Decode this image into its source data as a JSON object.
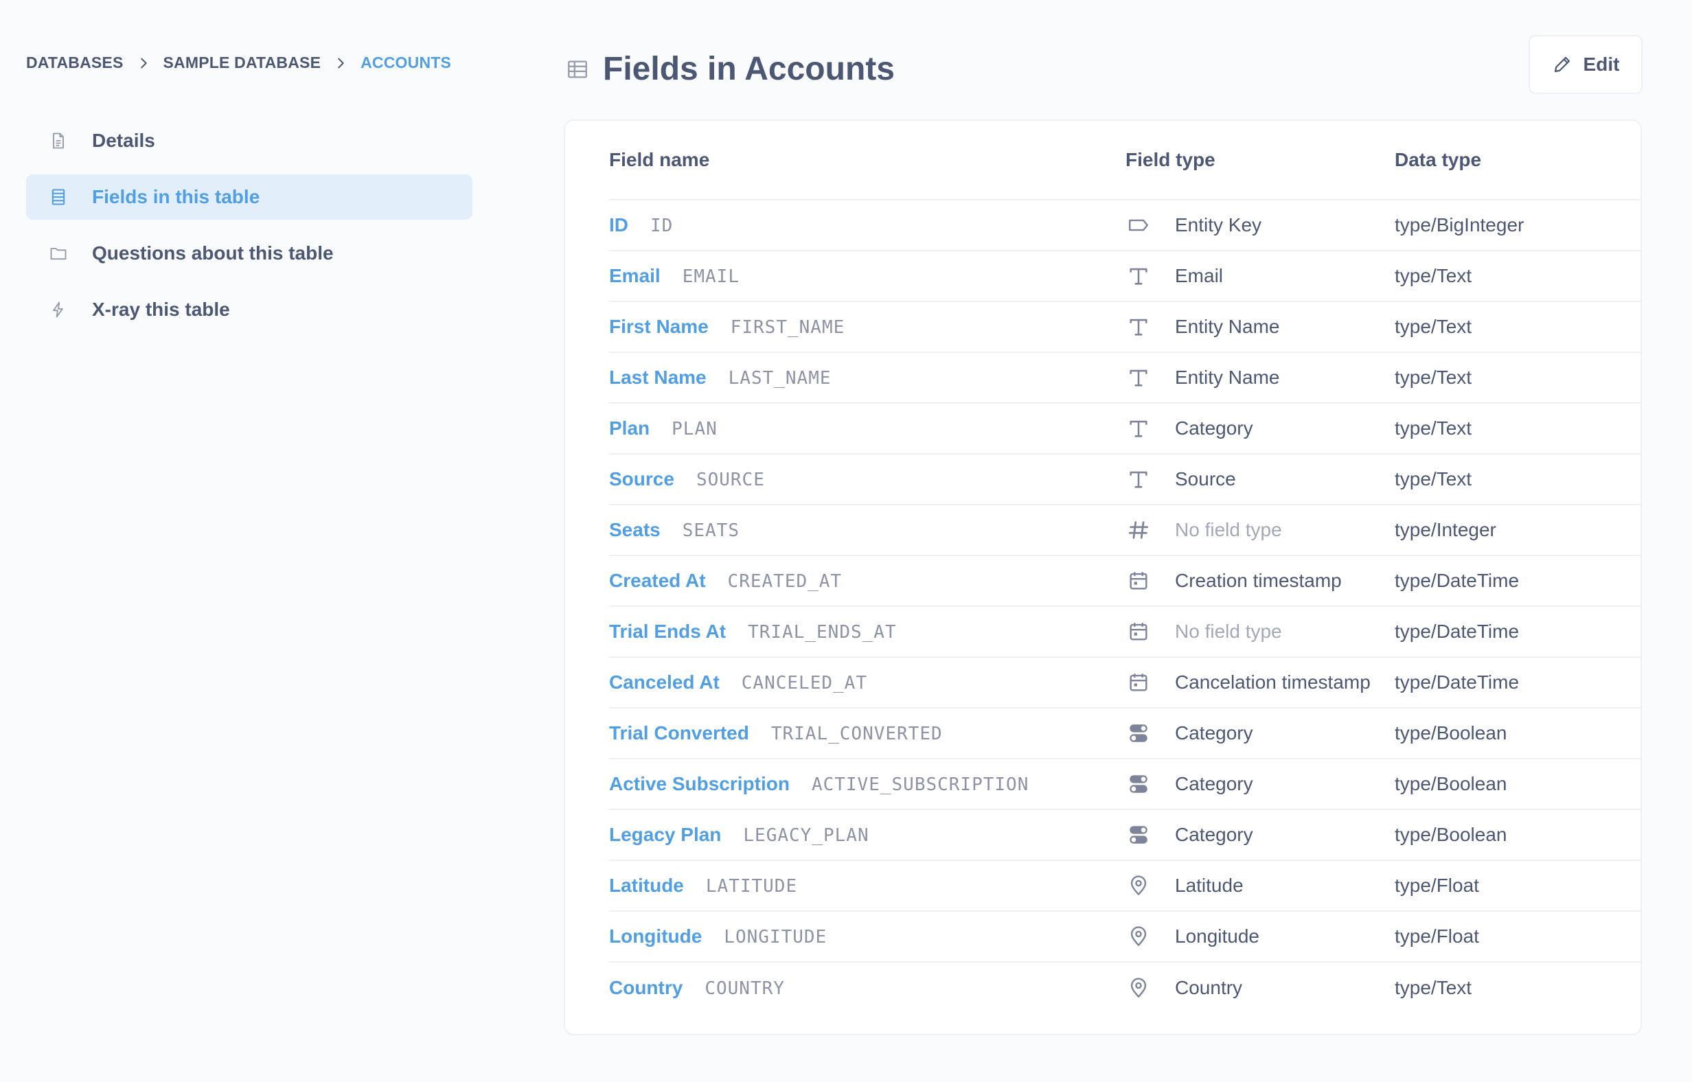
{
  "breadcrumb": {
    "items": [
      "DATABASES",
      "SAMPLE DATABASE",
      "ACCOUNTS"
    ]
  },
  "sidebar": {
    "items": [
      {
        "label": "Details",
        "icon": "document-icon"
      },
      {
        "label": "Fields in this table",
        "icon": "list-icon",
        "selected": true
      },
      {
        "label": "Questions about this table",
        "icon": "folder-icon"
      },
      {
        "label": "X-ray this table",
        "icon": "bolt-icon"
      }
    ]
  },
  "header": {
    "title": "Fields in Accounts",
    "edit_label": "Edit"
  },
  "table": {
    "columns": [
      "Field name",
      "Field type",
      "Data type"
    ],
    "rows": [
      {
        "name": "ID",
        "raw": "ID",
        "field_type": "Entity Key",
        "icon": "key-label-icon",
        "data_type": "type/BigInteger",
        "muted": false
      },
      {
        "name": "Email",
        "raw": "EMAIL",
        "field_type": "Email",
        "icon": "text-icon",
        "data_type": "type/Text",
        "muted": false
      },
      {
        "name": "First Name",
        "raw": "FIRST_NAME",
        "field_type": "Entity Name",
        "icon": "text-icon",
        "data_type": "type/Text",
        "muted": false
      },
      {
        "name": "Last Name",
        "raw": "LAST_NAME",
        "field_type": "Entity Name",
        "icon": "text-icon",
        "data_type": "type/Text",
        "muted": false
      },
      {
        "name": "Plan",
        "raw": "PLAN",
        "field_type": "Category",
        "icon": "text-icon",
        "data_type": "type/Text",
        "muted": false
      },
      {
        "name": "Source",
        "raw": "SOURCE",
        "field_type": "Source",
        "icon": "text-icon",
        "data_type": "type/Text",
        "muted": false
      },
      {
        "name": "Seats",
        "raw": "SEATS",
        "field_type": "No field type",
        "icon": "hash-icon",
        "data_type": "type/Integer",
        "muted": true
      },
      {
        "name": "Created At",
        "raw": "CREATED_AT",
        "field_type": "Creation timestamp",
        "icon": "calendar-icon",
        "data_type": "type/DateTime",
        "muted": false
      },
      {
        "name": "Trial Ends At",
        "raw": "TRIAL_ENDS_AT",
        "field_type": "No field type",
        "icon": "calendar-icon",
        "data_type": "type/DateTime",
        "muted": true
      },
      {
        "name": "Canceled At",
        "raw": "CANCELED_AT",
        "field_type": "Cancelation timestamp",
        "icon": "calendar-icon",
        "data_type": "type/DateTime",
        "muted": false
      },
      {
        "name": "Trial Converted",
        "raw": "TRIAL_CONVERTED",
        "field_type": "Category",
        "icon": "toggle-icon",
        "data_type": "type/Boolean",
        "muted": false
      },
      {
        "name": "Active Subscription",
        "raw": "ACTIVE_SUBSCRIPTION",
        "field_type": "Category",
        "icon": "toggle-icon",
        "data_type": "type/Boolean",
        "muted": false
      },
      {
        "name": "Legacy Plan",
        "raw": "LEGACY_PLAN",
        "field_type": "Category",
        "icon": "toggle-icon",
        "data_type": "type/Boolean",
        "muted": false
      },
      {
        "name": "Latitude",
        "raw": "LATITUDE",
        "field_type": "Latitude",
        "icon": "location-pin-icon",
        "data_type": "type/Float",
        "muted": false
      },
      {
        "name": "Longitude",
        "raw": "LONGITUDE",
        "field_type": "Longitude",
        "icon": "location-pin-icon",
        "data_type": "type/Float",
        "muted": false
      },
      {
        "name": "Country",
        "raw": "COUNTRY",
        "field_type": "Country",
        "icon": "location-pin-icon",
        "data_type": "type/Text",
        "muted": false
      }
    ]
  },
  "colors": {
    "accent": "#509ee3",
    "text": "#4c5773",
    "selected_bg": "#e2eef9",
    "muted": "#a3a8b7"
  }
}
